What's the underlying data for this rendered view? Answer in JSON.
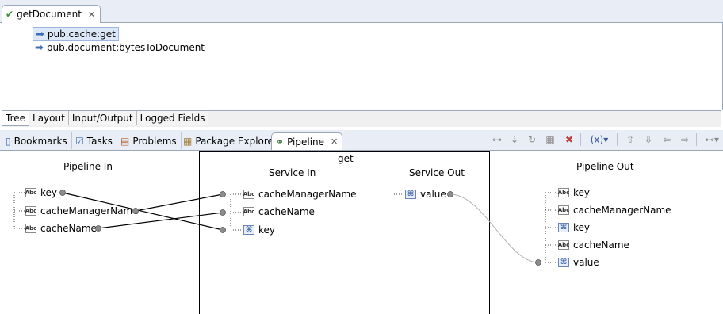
{
  "editor": {
    "tab_title": "getDocument",
    "tree_items": [
      "pub.cache:get",
      "pub.document:bytesToDocument"
    ],
    "bottom_tabs": [
      "Tree",
      "Layout",
      "Input/Output",
      "Logged Fields"
    ]
  },
  "views": {
    "tabs": [
      "Bookmarks",
      "Tasks",
      "Problems",
      "Package Explorer",
      "Pipeline"
    ],
    "active_tab": "Pipeline",
    "toolbar_icons": [
      "link-icon",
      "map-icon",
      "refresh-icon",
      "grid-icon",
      "delete-icon",
      "variable-icon",
      "up-icon",
      "down-icon",
      "left-icon",
      "right-icon",
      "more-icon"
    ]
  },
  "pipeline": {
    "service_name": "get",
    "pipeline_in": {
      "title": "Pipeline In",
      "fields": [
        {
          "label": "key",
          "type": "string"
        },
        {
          "label": "cacheManagerName",
          "type": "string"
        },
        {
          "label": "cacheName",
          "type": "string"
        }
      ]
    },
    "service_in": {
      "title": "Service In",
      "fields": [
        {
          "label": "cacheManagerName",
          "type": "string"
        },
        {
          "label": "cacheName",
          "type": "string"
        },
        {
          "label": "key",
          "type": "object"
        }
      ]
    },
    "service_out": {
      "title": "Service Out",
      "fields": [
        {
          "label": "value",
          "type": "object"
        }
      ]
    },
    "pipeline_out": {
      "title": "Pipeline Out",
      "fields": [
        {
          "label": "key",
          "type": "string"
        },
        {
          "label": "cacheManagerName",
          "type": "string"
        },
        {
          "label": "key",
          "type": "object"
        },
        {
          "label": "cacheName",
          "type": "string"
        },
        {
          "label": "value",
          "type": "object"
        }
      ]
    },
    "icon_text": {
      "string": "Abc",
      "object": "⌘"
    }
  }
}
